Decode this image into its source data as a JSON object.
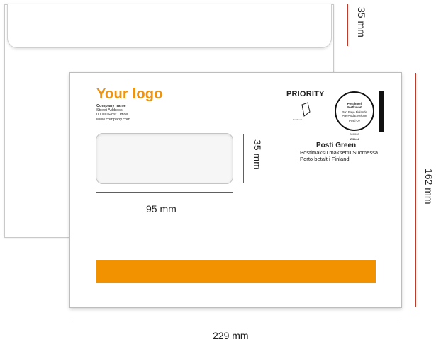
{
  "logo": {
    "text": "Your logo"
  },
  "address": {
    "name": "Company name",
    "street": "Street Address",
    "post": "00000 Post Office",
    "web": "www.company.com"
  },
  "postage": {
    "priority": "PRIORITY",
    "stamp_lines": [
      "Postikuori",
      "Postkuvert",
      "Port Payé Finlande",
      "Pre-Paid Envelope",
      "Posti Oy"
    ],
    "stamp_number": "000000",
    "stamp_walli": "WALLI",
    "fine_print": "Postikuori",
    "service": "Posti Green",
    "paid_fi": "Postimaksu maksettu Suomessa",
    "paid_sv": "Porto betalt i Finland"
  },
  "dimensions": {
    "flap_height": "35 mm",
    "window_height": "35 mm",
    "window_width": "95 mm",
    "envelope_height": "162 mm",
    "envelope_width": "229 mm"
  },
  "colors": {
    "accent": "#f39200",
    "logo": "#f0930a",
    "dimension_line": "#c0392b"
  }
}
